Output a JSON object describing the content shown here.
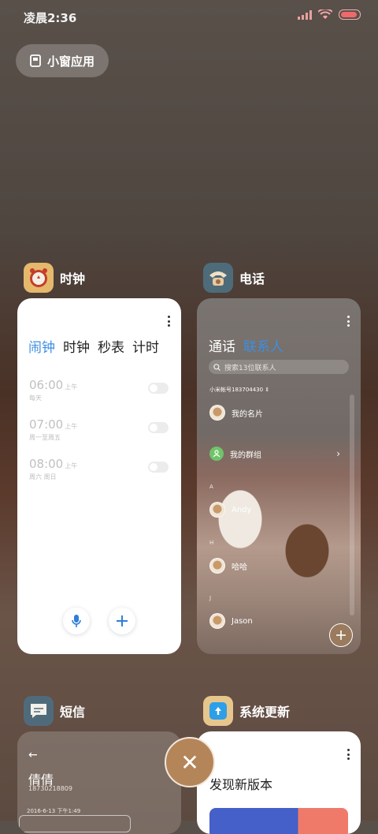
{
  "status": {
    "time": "凌晨2:36"
  },
  "floating": {
    "label": "小窗应用"
  },
  "apps": {
    "clock": {
      "name": "时钟",
      "tabs": [
        "闹钟",
        "时钟",
        "秒表",
        "计时"
      ],
      "alarms": [
        {
          "time": "06:00",
          "ampm": "上午",
          "repeat": "每天"
        },
        {
          "time": "07:00",
          "ampm": "上午",
          "repeat": "周一至周五"
        },
        {
          "time": "08:00",
          "ampm": "上午",
          "repeat": "周六 周日"
        }
      ]
    },
    "phone": {
      "name": "电话",
      "tabs": [
        "通话",
        "联系人"
      ],
      "search_placeholder": "搜索13位联系人",
      "account": "小米帐号183704430",
      "my_card": "我的名片",
      "my_groups": "我的群组",
      "sections": [
        {
          "letter": "A",
          "contact": "Andy"
        },
        {
          "letter": "H",
          "contact": "哈哈"
        },
        {
          "letter": "J",
          "contact": "Jason"
        }
      ]
    },
    "sms": {
      "name": "短信",
      "contact": "倩倩",
      "number": "18730218809",
      "date": "2016-6-13 下午1:49"
    },
    "update": {
      "name": "系统更新",
      "headline": "发现新版本"
    }
  },
  "colors": {
    "accent": "#3d8fe0",
    "close": "#b5855a",
    "battery": "#ee6a6a"
  }
}
